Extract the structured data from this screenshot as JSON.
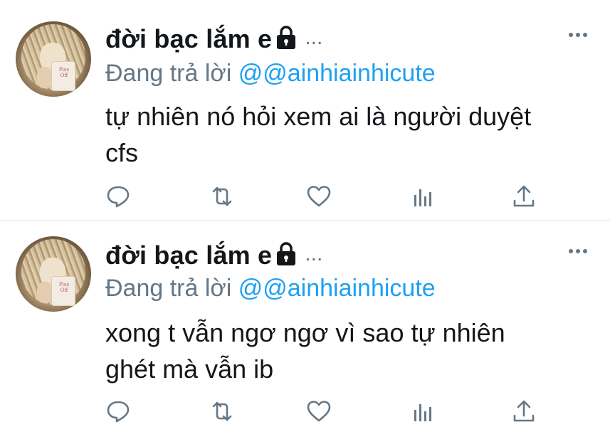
{
  "colors": {
    "text_primary": "#14171a",
    "text_secondary": "#657786",
    "link": "#1da1f2",
    "divider": "#e1e8ed"
  },
  "tweets": [
    {
      "name": "đời bạc lắm e",
      "handle_ellipsis": "...",
      "reply_prefix": "Đang trả lời",
      "reply_handle": "@@ainhiainhicute",
      "body_lines": [
        "tự nhiên nó hỏi xem ai là người duyệt",
        "cfs"
      ],
      "icons": [
        "lock-icon",
        "more-icon",
        "reply-icon",
        "retweet-icon",
        "like-icon",
        "analytics-icon",
        "share-icon"
      ]
    },
    {
      "name": "đời bạc lắm e",
      "handle_ellipsis": "...",
      "reply_prefix": "Đang trả lời",
      "reply_handle": "@@ainhiainhicute",
      "body_lines": [
        "xong t vẫn ngơ ngơ vì sao tự nhiên",
        "ghét mà vẫn ib"
      ],
      "icons": [
        "lock-icon",
        "more-icon",
        "reply-icon",
        "retweet-icon",
        "like-icon",
        "analytics-icon",
        "share-icon"
      ]
    }
  ],
  "avatar_mug_text": "Piss Off"
}
